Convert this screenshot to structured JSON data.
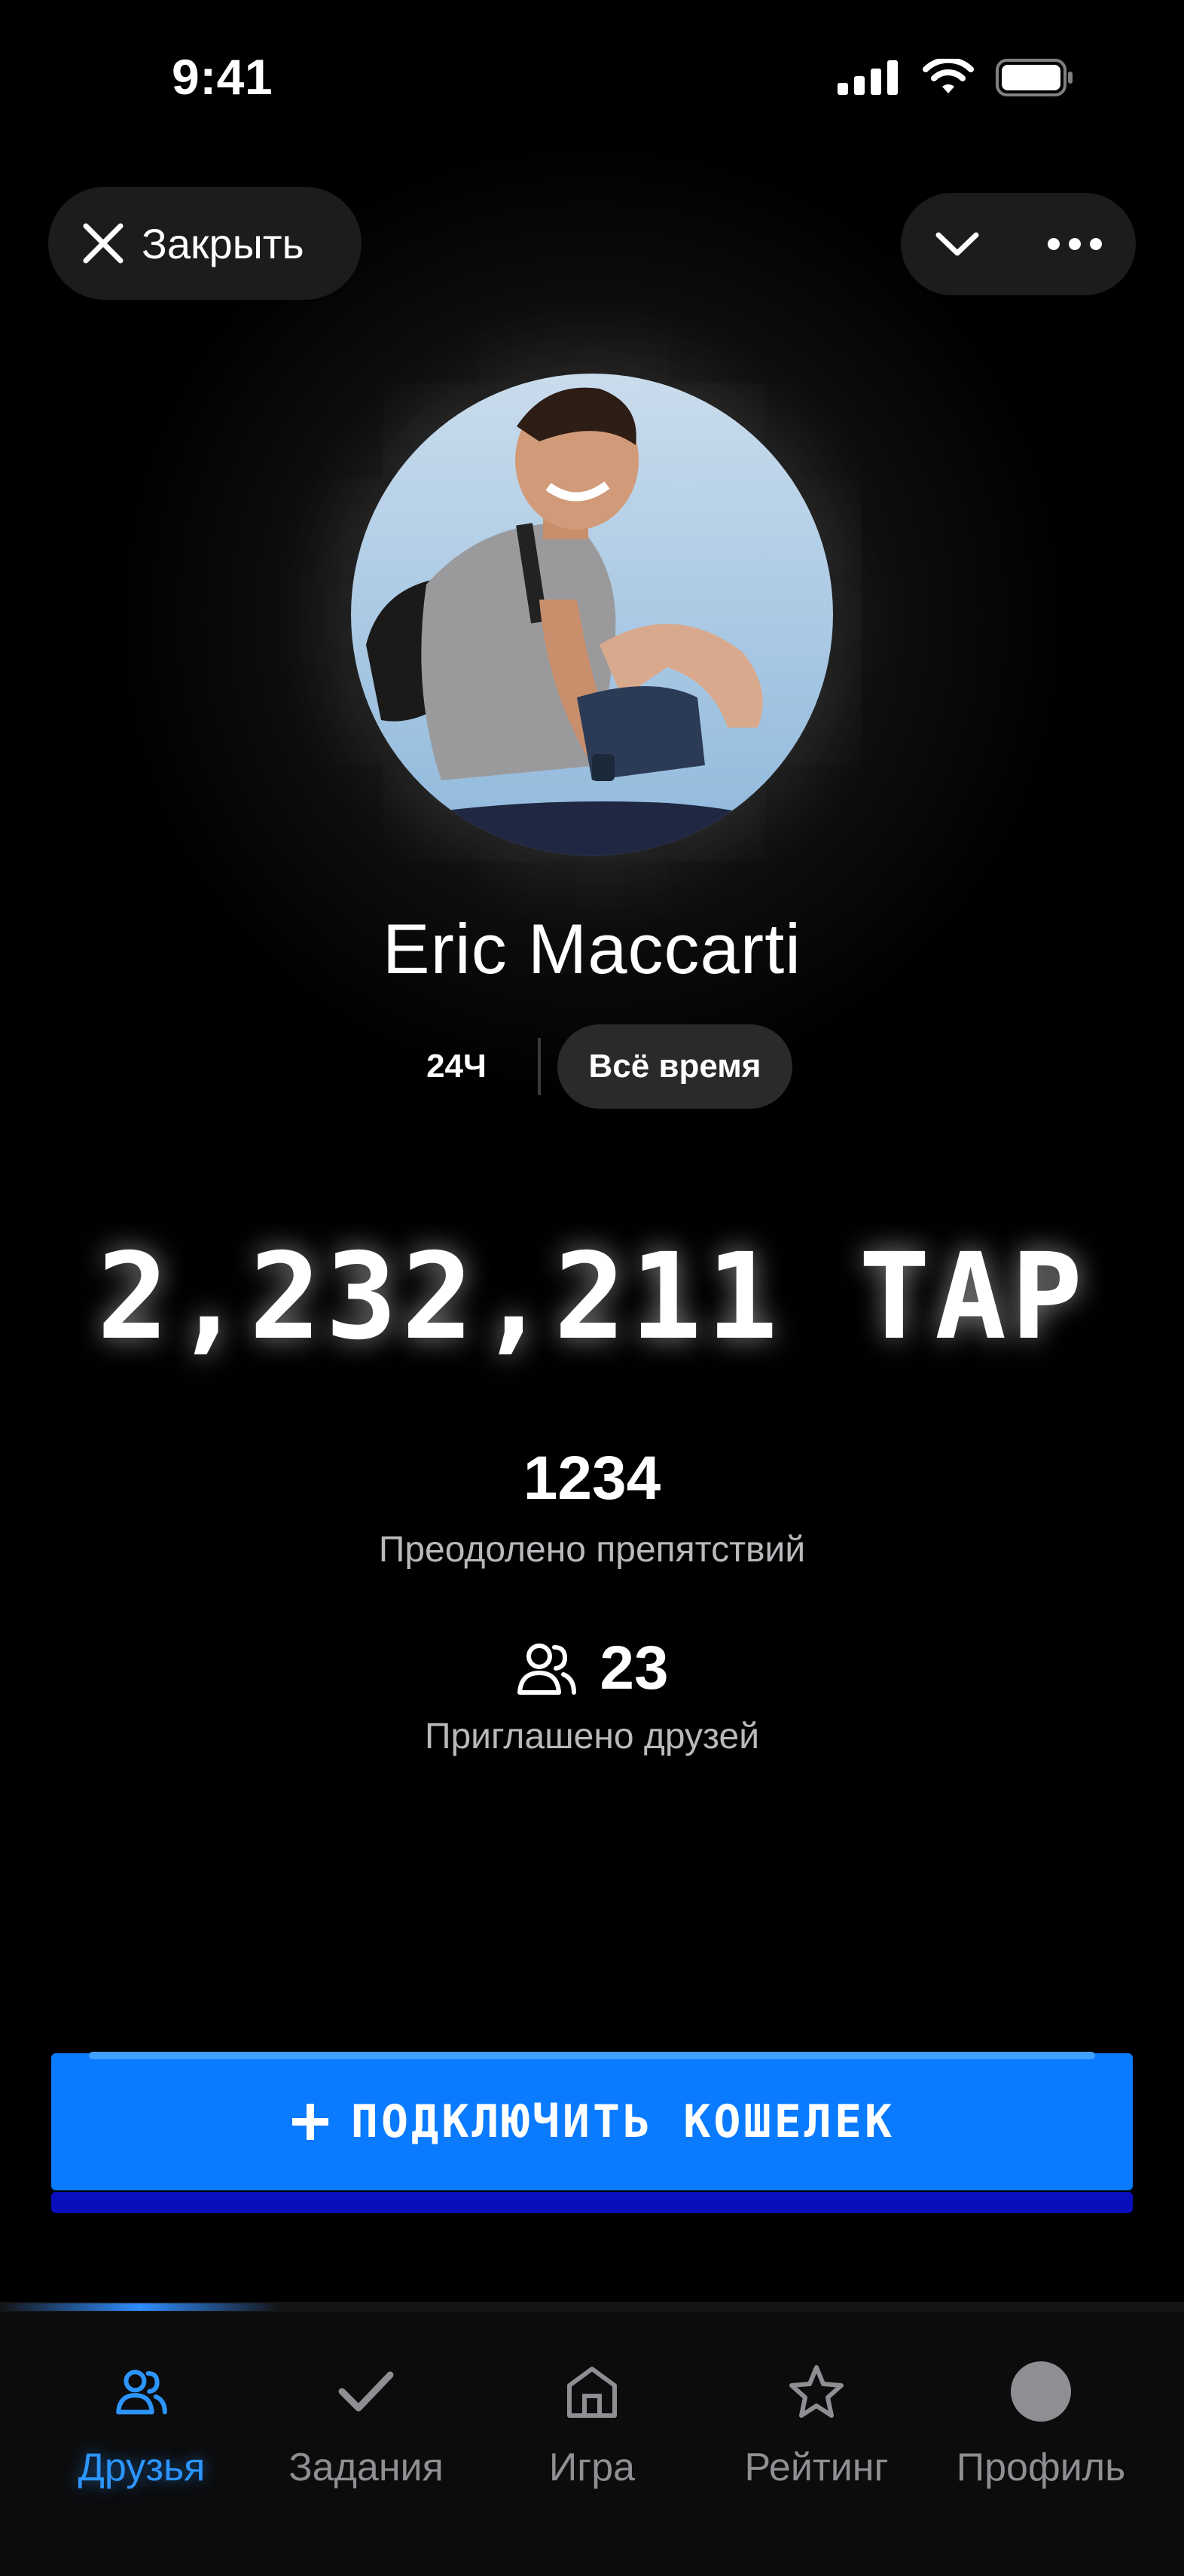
{
  "status": {
    "time": "9:41"
  },
  "header": {
    "close_label": "Закрыть"
  },
  "profile": {
    "name": "Eric Maccarti"
  },
  "period": {
    "day_label": "24Ч",
    "all_time_label": "Всё время"
  },
  "score": {
    "value": "2,232,211 TAP"
  },
  "stats": {
    "obstacles_value": "1234",
    "obstacles_label": "Преодолено препятствий",
    "friends_value": "23",
    "friends_label": "Приглашено друзей"
  },
  "wallet": {
    "label": "ПОДКЛЮЧИТЬ КОШЕЛЕК"
  },
  "tabs": [
    {
      "label": "Друзья",
      "icon": "friends-icon",
      "active": true
    },
    {
      "label": "Задания",
      "icon": "check-icon",
      "active": false
    },
    {
      "label": "Игра",
      "icon": "home-icon",
      "active": false
    },
    {
      "label": "Рейтинг",
      "icon": "star-icon",
      "active": false
    },
    {
      "label": "Профиль",
      "icon": "profile-avatar-icon",
      "active": false
    }
  ],
  "colors": {
    "accent": "#0a7bff",
    "active_tab": "#2c95ff",
    "background": "#000000"
  }
}
